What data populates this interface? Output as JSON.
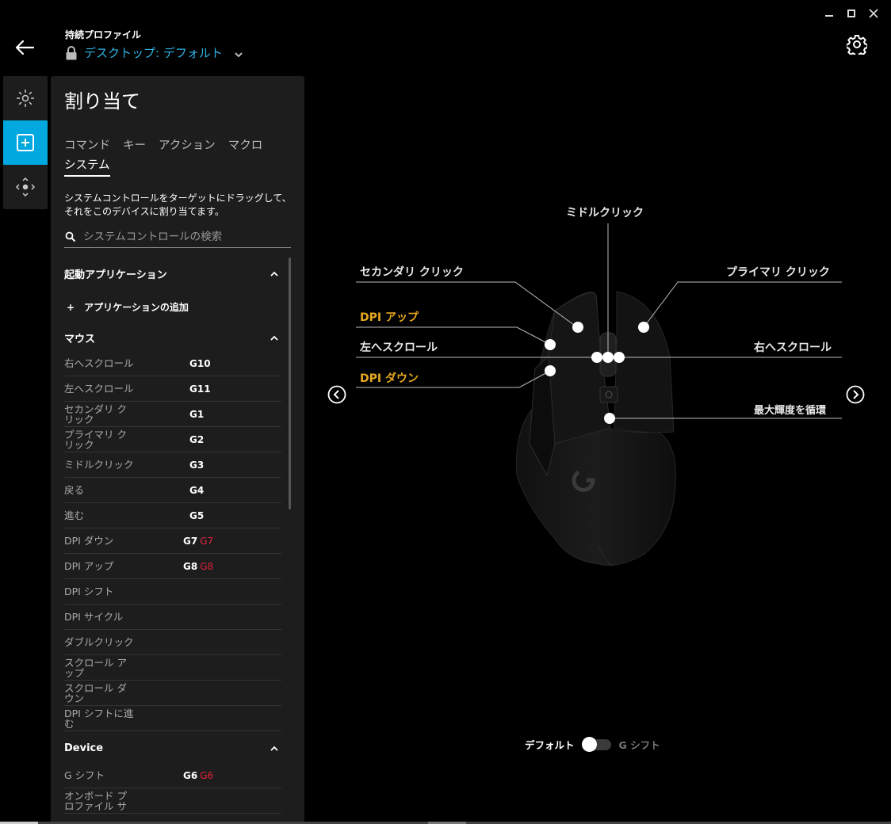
{
  "header": {
    "profile_label": "持続プロファイル",
    "profile_name": "デスクトップ: デフォルト"
  },
  "panel": {
    "title": "割り当て",
    "tabs": [
      {
        "label": "コマンド"
      },
      {
        "label": "キー"
      },
      {
        "label": "アクション"
      },
      {
        "label": "マクロ"
      },
      {
        "label": "システム",
        "active": true
      }
    ],
    "description": "システムコントロールをターゲットにドラッグして、それをこのデバイスに割り当てます。",
    "search_placeholder": "システムコントロールの検索",
    "sections": {
      "apps": {
        "title": "起動アプリケーション",
        "add_label": "アプリケーションの追加"
      },
      "mouse": {
        "title": "マウス",
        "items": [
          {
            "name": "右へスクロール",
            "g": "G10",
            "g_shift": ""
          },
          {
            "name": "左へスクロール",
            "g": "G11",
            "g_shift": ""
          },
          {
            "name": "セカンダリ ク\nリック",
            "g": "G1",
            "g_shift": ""
          },
          {
            "name": "プライマリ ク\nリック",
            "g": "G2",
            "g_shift": ""
          },
          {
            "name": "ミドルクリック",
            "g": "G3",
            "g_shift": ""
          },
          {
            "name": "戻る",
            "g": "G4",
            "g_shift": ""
          },
          {
            "name": "進む",
            "g": "G5",
            "g_shift": ""
          },
          {
            "name": "DPI ダウン",
            "g": "G7",
            "g_shift": "G7"
          },
          {
            "name": "DPI アップ",
            "g": "G8",
            "g_shift": "G8"
          },
          {
            "name": "DPI シフト",
            "g": "",
            "g_shift": ""
          },
          {
            "name": "DPI サイクル",
            "g": "",
            "g_shift": ""
          },
          {
            "name": "ダブルクリック",
            "g": "",
            "g_shift": ""
          },
          {
            "name": "スクロール ア\nップ",
            "g": "",
            "g_shift": ""
          },
          {
            "name": "スクロール ダ\nウン",
            "g": "",
            "g_shift": ""
          },
          {
            "name": "DPI シフトに進\nむ",
            "g": "",
            "g_shift": ""
          }
        ]
      },
      "device": {
        "title": "Device",
        "items": [
          {
            "name": "G シフト",
            "g": "G6",
            "g_shift": "G6"
          },
          {
            "name": "オンボード プ\nロファイル サ",
            "g": "",
            "g_shift": ""
          }
        ]
      }
    }
  },
  "mouse_labels": {
    "middle_click": "ミドルクリック",
    "secondary_click": "セカンダリ クリック",
    "primary_click": "プライマリ クリック",
    "dpi_up": "DPI アップ",
    "scroll_left": "左へスクロール",
    "scroll_right": "右へスクロール",
    "dpi_down": "DPI ダウン",
    "brightness_cycle": "最大輝度を循環"
  },
  "toggle": {
    "default_label": "デフォルト",
    "gshift_label": "G シフト",
    "state": "default"
  },
  "colors": {
    "accent": "#00a8e0",
    "link": "#2fb4e6",
    "amber": "#e6a81e",
    "shift_red": "#e0223a"
  }
}
